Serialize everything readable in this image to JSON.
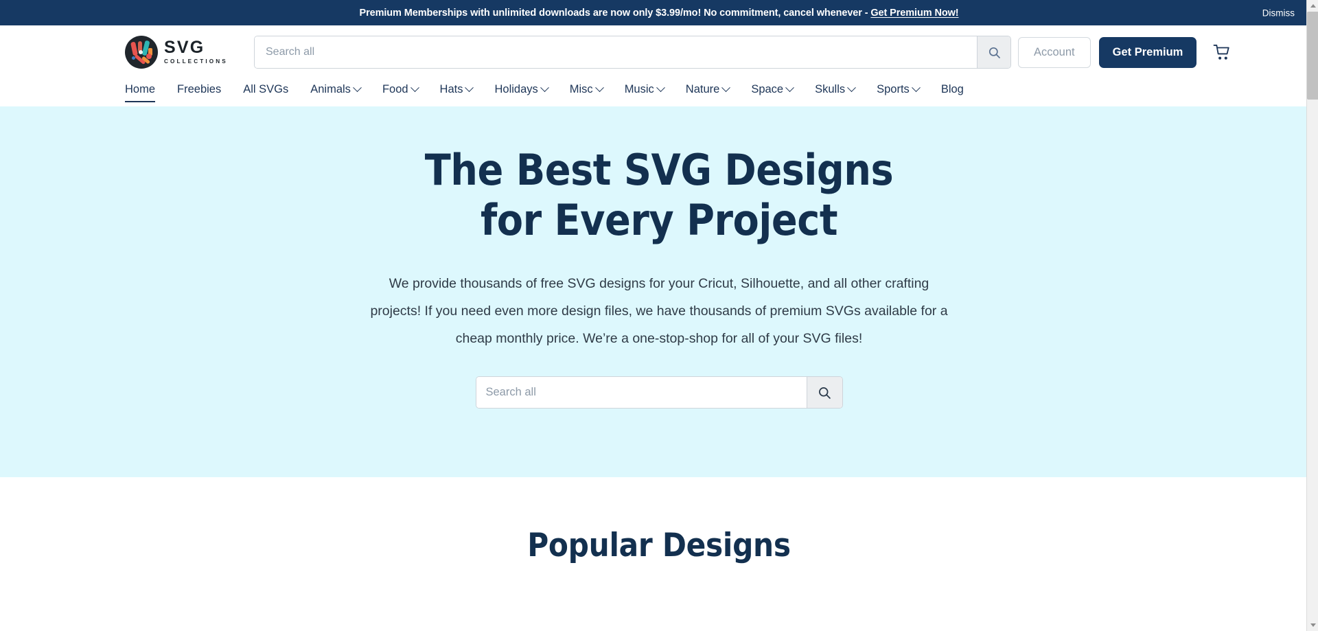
{
  "announcement": {
    "text_before": "Premium Memberships with unlimited downloads are now only $3.99/mo! No commitment, cancel whenever - ",
    "link_label": "Get Premium Now!",
    "dismiss_label": "Dismiss",
    "bg_color": "#163963"
  },
  "header": {
    "logo": {
      "primary": "SVG",
      "secondary": "COLLECTIONS",
      "icon": "svg-collections-logo-mark"
    },
    "search": {
      "placeholder": "Search all",
      "value": "",
      "button_icon": "search-icon"
    },
    "account_label": "Account",
    "premium_label": "Get Premium",
    "cart_icon": "shopping-cart-icon"
  },
  "nav": {
    "items": [
      {
        "label": "Home",
        "has_dropdown": false,
        "active": true
      },
      {
        "label": "Freebies",
        "has_dropdown": false,
        "active": false
      },
      {
        "label": "All SVGs",
        "has_dropdown": false,
        "active": false
      },
      {
        "label": "Animals",
        "has_dropdown": true,
        "active": false
      },
      {
        "label": "Food",
        "has_dropdown": true,
        "active": false
      },
      {
        "label": "Hats",
        "has_dropdown": true,
        "active": false
      },
      {
        "label": "Holidays",
        "has_dropdown": true,
        "active": false
      },
      {
        "label": "Misc",
        "has_dropdown": true,
        "active": false
      },
      {
        "label": "Music",
        "has_dropdown": true,
        "active": false
      },
      {
        "label": "Nature",
        "has_dropdown": true,
        "active": false
      },
      {
        "label": "Space",
        "has_dropdown": true,
        "active": false
      },
      {
        "label": "Skulls",
        "has_dropdown": true,
        "active": false
      },
      {
        "label": "Sports",
        "has_dropdown": true,
        "active": false
      },
      {
        "label": "Blog",
        "has_dropdown": false,
        "active": false
      }
    ]
  },
  "hero": {
    "bg_color": "#ddf8fd",
    "heading_line1": "The Best SVG Designs",
    "heading_line2": "for Every Project",
    "heading_color": "#13304f",
    "paragraph": "We provide thousands of free SVG designs for your Cricut, Silhouette, and all other crafting projects! If you need even more design files, we have thousands of premium SVGs available for a cheap monthly price. We’re a one-stop-shop for all of your SVG files!",
    "search": {
      "placeholder": "Search all",
      "value": "",
      "button_icon": "search-icon"
    }
  },
  "popular": {
    "heading": "Popular Designs"
  }
}
